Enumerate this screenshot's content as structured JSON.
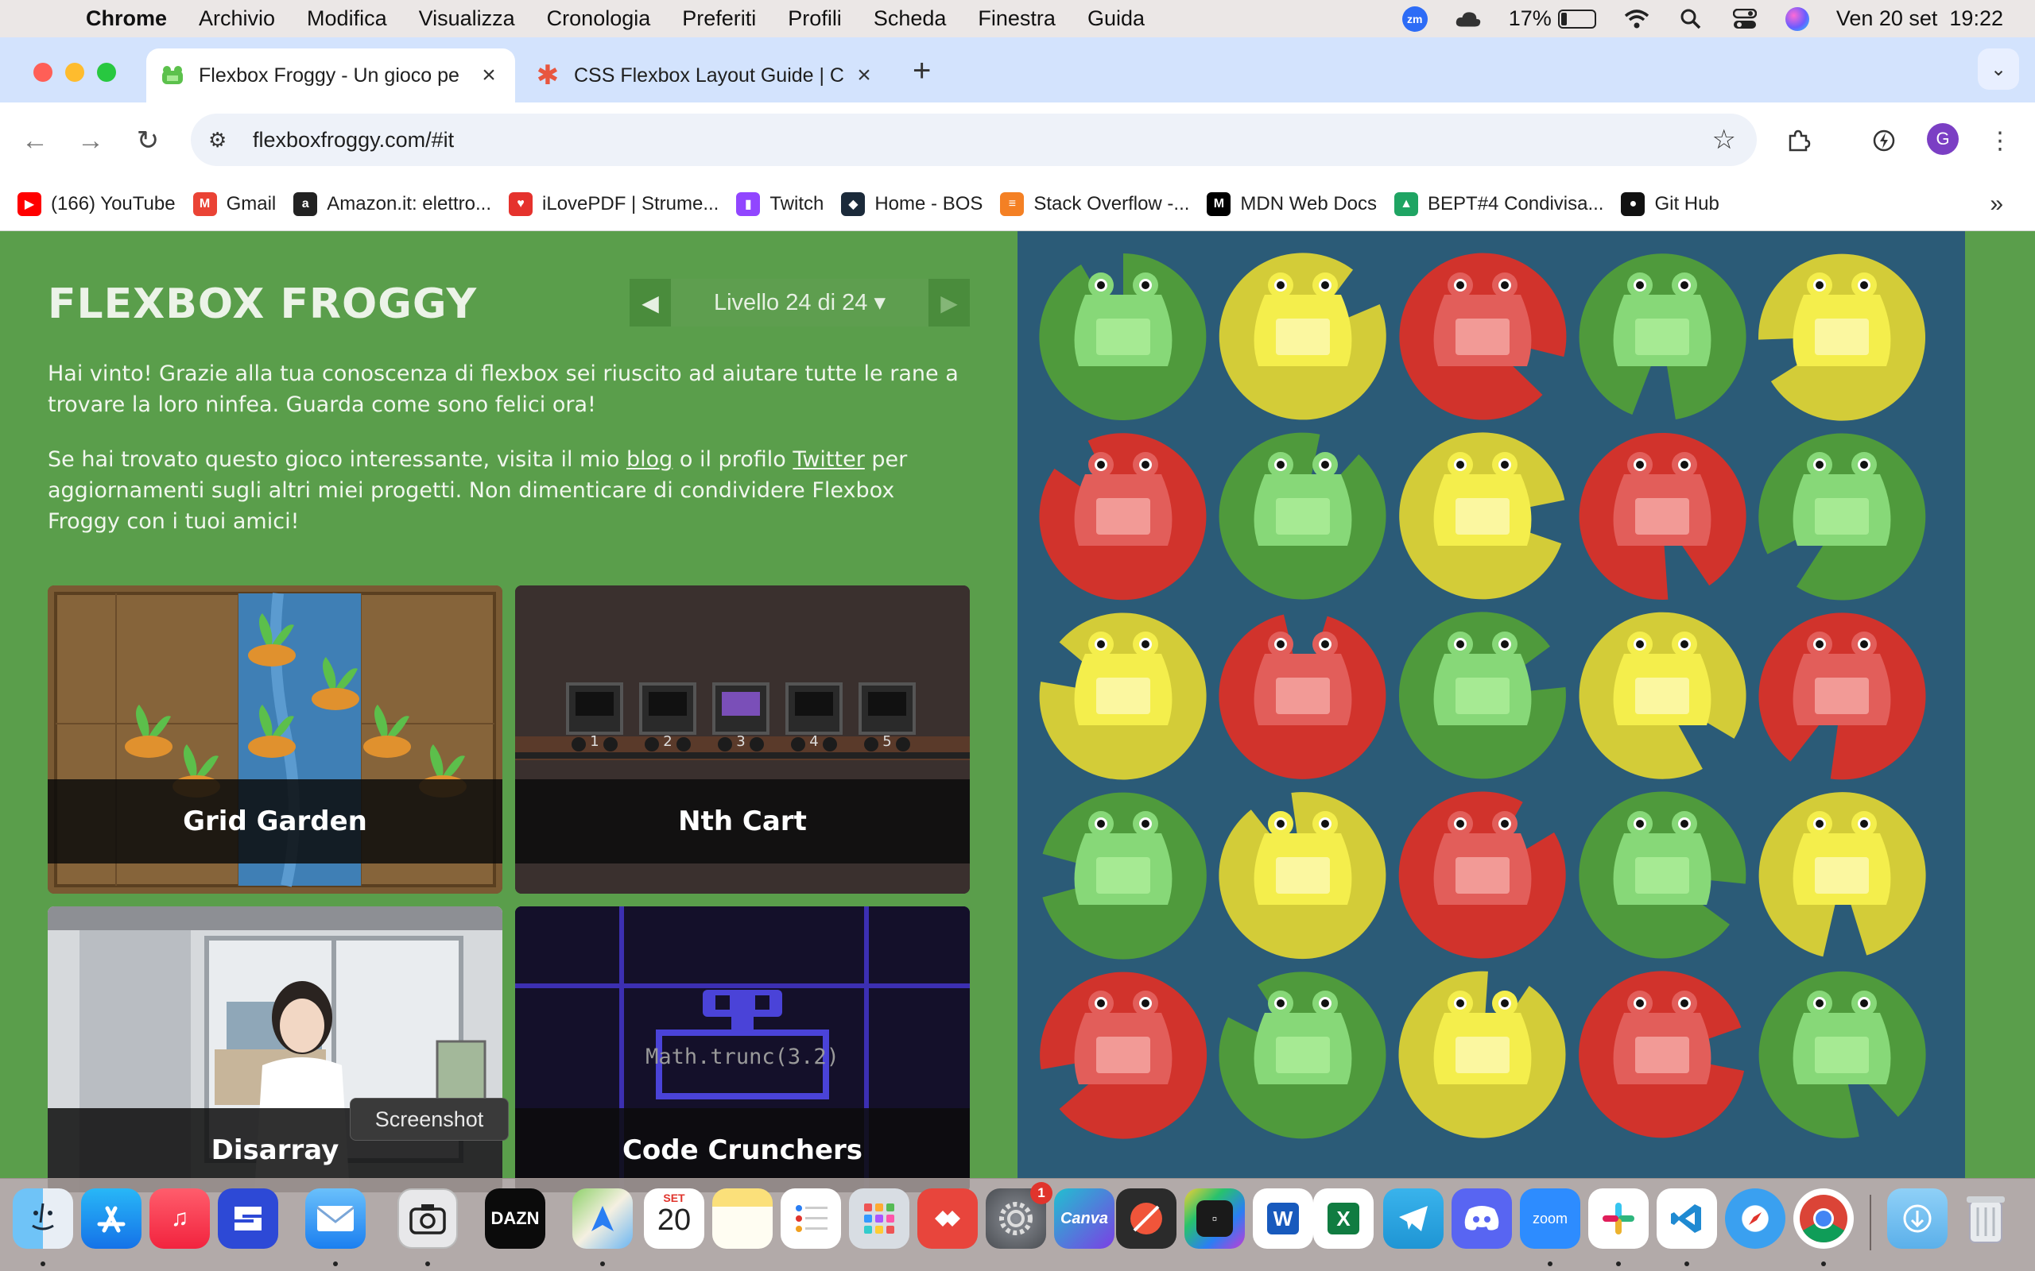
{
  "menubar": {
    "app": "Chrome",
    "items": [
      "Archivio",
      "Modifica",
      "Visualizza",
      "Cronologia",
      "Preferiti",
      "Profili",
      "Scheda",
      "Finestra",
      "Guida"
    ],
    "zoom_badge": "zm",
    "battery_percent": "17%",
    "battery_level": 0.17,
    "datetime": "Ven 20 set  19:22"
  },
  "tabs": [
    {
      "title": "Flexbox Froggy - Un gioco pe",
      "active": true,
      "favicon": "frog-icon"
    },
    {
      "title": "CSS Flexbox Layout Guide | C",
      "active": false,
      "favicon": "asterisk-icon"
    }
  ],
  "toolbar": {
    "url": "flexboxfroggy.com/#it",
    "profile_initial": "G"
  },
  "bookmarks": [
    {
      "label": "(166) YouTube",
      "icon": "youtube-icon",
      "color": "#ff0000",
      "glyph": "▶"
    },
    {
      "label": "Gmail",
      "icon": "gmail-icon",
      "color": "#ea4335",
      "glyph": "M"
    },
    {
      "label": "Amazon.it: elettro...",
      "icon": "amazon-icon",
      "color": "#222222",
      "glyph": "a"
    },
    {
      "label": "iLovePDF | Strume...",
      "icon": "ilovepdf-icon",
      "color": "#e5322d",
      "glyph": "♥"
    },
    {
      "label": "Twitch",
      "icon": "twitch-icon",
      "color": "#9146ff",
      "glyph": "▮"
    },
    {
      "label": "Home - BOS",
      "icon": "bos-icon",
      "color": "#1b2a3a",
      "glyph": "◆"
    },
    {
      "label": "Stack Overflow -...",
      "icon": "stackoverflow-icon",
      "color": "#f48024",
      "glyph": "≡"
    },
    {
      "label": "MDN Web Docs",
      "icon": "mdn-icon",
      "color": "#000000",
      "glyph": "M"
    },
    {
      "label": "BEPT#4 Condivisa...",
      "icon": "google-drive-icon",
      "color": "#1fa463",
      "glyph": "▲"
    },
    {
      "label": "Git Hub",
      "icon": "github-icon",
      "color": "#111111",
      "glyph": "●"
    }
  ],
  "game": {
    "logo": "FLEXBOX FROGGY",
    "level_label": "Livello 24 di 24",
    "intro_p1": "Hai vinto! Grazie alla tua conoscenza di flexbox sei riuscito ad aiutare tutte le rane a trovare la loro ninfea. Guarda come sono felici ora!",
    "intro_p2_a": "Se hai trovato questo gioco interessante, visita il mio ",
    "intro_link_blog": "blog",
    "intro_p2_b": " o il profilo ",
    "intro_link_twitter": "Twitter",
    "intro_p2_c": " per aggiornamenti sugli altri miei progetti. Non dimenticare di condividere Flexbox Froggy con i tuoi amici!",
    "cards": [
      "Grid Garden",
      "Nth Cart",
      "Disarray",
      "Code Crunchers"
    ],
    "cart_numbers": [
      "1",
      "2",
      "3",
      "4",
      "5"
    ],
    "code_text": "Math.trunc(3.2)",
    "board_colors": [
      [
        "green",
        "yellow",
        "red",
        "green",
        "yellow"
      ],
      [
        "red",
        "green",
        "yellow",
        "red",
        "green"
      ],
      [
        "yellow",
        "red",
        "green",
        "yellow",
        "red"
      ],
      [
        "green",
        "yellow",
        "red",
        "green",
        "yellow"
      ],
      [
        "red",
        "green",
        "yellow",
        "red",
        "green"
      ]
    ]
  },
  "tooltip": "Screenshot",
  "dock": {
    "calendar_month": "SET",
    "calendar_day": "20",
    "settings_badge": "1",
    "canva_label": "Canva",
    "zoom_label": "zoom",
    "dazn_label": "DAZN",
    "word_label": "W",
    "excel_label": "X"
  },
  "colors": {
    "sidebar_green": "#5a9e4b",
    "board_blue": "#2b5b77",
    "pad_green": "#4f9a3c",
    "pad_yellow": "#d3cc38",
    "pad_red": "#d1332c",
    "frog_green": "#87d878",
    "frog_yellow": "#f4ee4c",
    "frog_red": "#e25e5a"
  }
}
